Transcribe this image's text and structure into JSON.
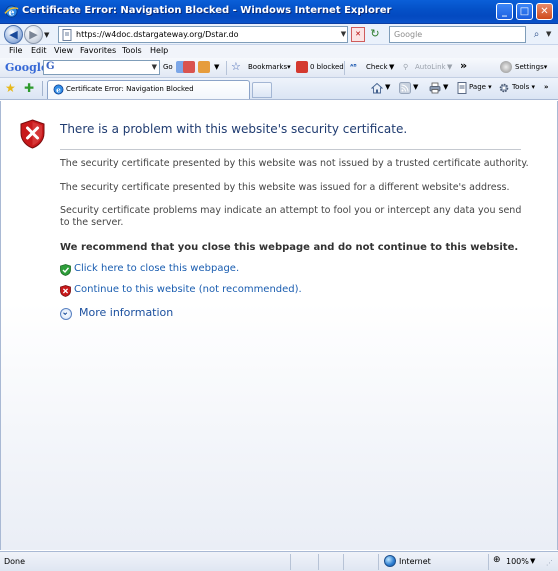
{
  "window": {
    "title": "Certificate Error: Navigation Blocked - Windows Internet Explorer",
    "minimize_glyph": "_",
    "maximize_glyph": "□",
    "close_glyph": "✕"
  },
  "address_bar": {
    "url": "https://w4doc.dstargateway.org/Dstar.do",
    "search_placeholder": "Google",
    "cert_error_glyph": "✕"
  },
  "menu": {
    "items": [
      "File",
      "Edit",
      "View",
      "Favorites",
      "Tools",
      "Help"
    ]
  },
  "google_toolbar": {
    "logo": "Google",
    "go_label": "Go",
    "bookmarks_label": "Bookmarks▾",
    "blocked_label": "0 blocked",
    "check_label": "Check",
    "autolink_label": "AutoLink",
    "more_glyph": "»",
    "settings_label": "Settings▾"
  },
  "tabs": {
    "active_label": "Certificate Error: Navigation Blocked",
    "page_label": "Page",
    "tools_label": "Tools"
  },
  "content": {
    "heading": "There is a problem with this website's security certificate.",
    "para1_line1": "The security certificate presented by this website was not issued by a trusted certificate authority.",
    "para1_line2": "The security certificate presented by this website was issued for a different website's address.",
    "para2": "Security certificate problems may indicate an attempt to fool you or intercept any data you send to the server.",
    "recommend": "We recommend that you close this webpage and do not continue to this website.",
    "close_link": "Click here to close this webpage.",
    "continue_link": "Continue to this website (not recommended).",
    "more_info": "More information"
  },
  "status_bar": {
    "status": "Done",
    "zone": "Internet",
    "zoom": "100%"
  },
  "colors": {
    "titlebar": "#0451c8",
    "heading": "#1f3b70",
    "link": "#1a5db0",
    "shield_red": "#c8191b"
  }
}
